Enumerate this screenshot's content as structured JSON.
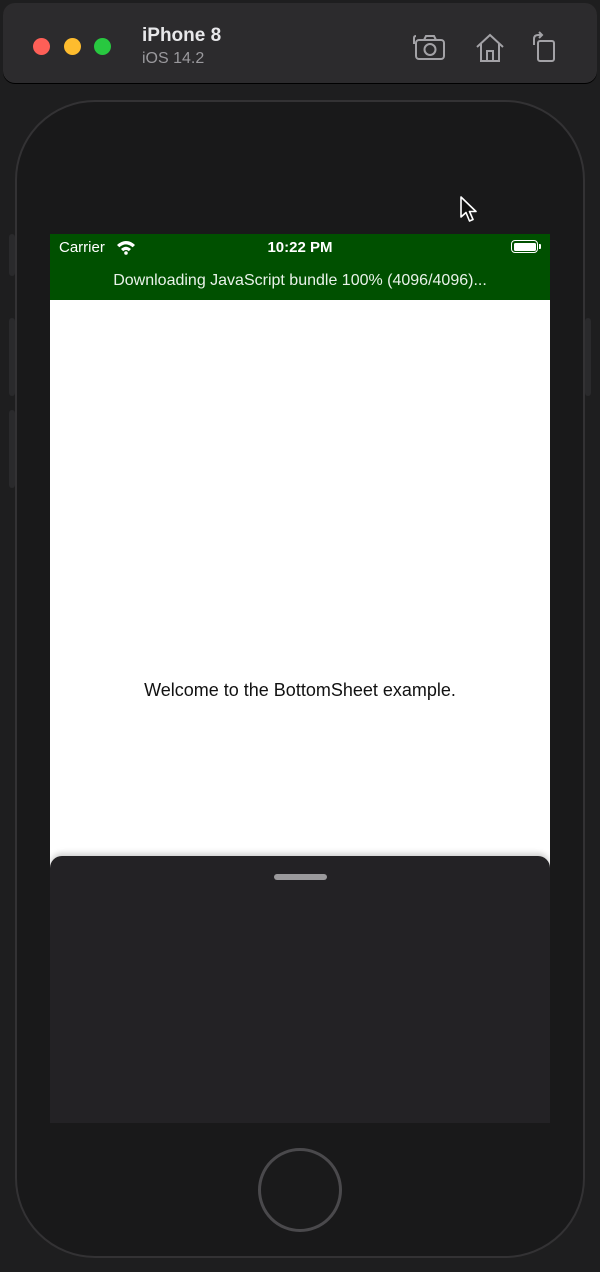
{
  "window": {
    "device_name": "iPhone 8",
    "os_version": "iOS 14.2",
    "toolbar": [
      {
        "name": "screenshot-button",
        "icon": "camera-icon"
      },
      {
        "name": "home-toolbar-button",
        "icon": "home-icon"
      },
      {
        "name": "rotate-button",
        "icon": "rotate-icon"
      }
    ]
  },
  "status_bar": {
    "carrier": "Carrier",
    "time": "10:22 PM",
    "wifi_icon": "wifi-icon",
    "battery_icon": "battery-icon"
  },
  "banner": {
    "text": "Downloading JavaScript bundle 100% (4096/4096)..."
  },
  "app": {
    "welcome_text": "Welcome to the BottomSheet example."
  },
  "colors": {
    "status_bar_bg": "#005000",
    "sheet_bg": "#232225",
    "screen_bg": "#ffffff",
    "traffic_red": "#fe5f57",
    "traffic_yellow": "#febc2e",
    "traffic_green": "#28c840"
  }
}
